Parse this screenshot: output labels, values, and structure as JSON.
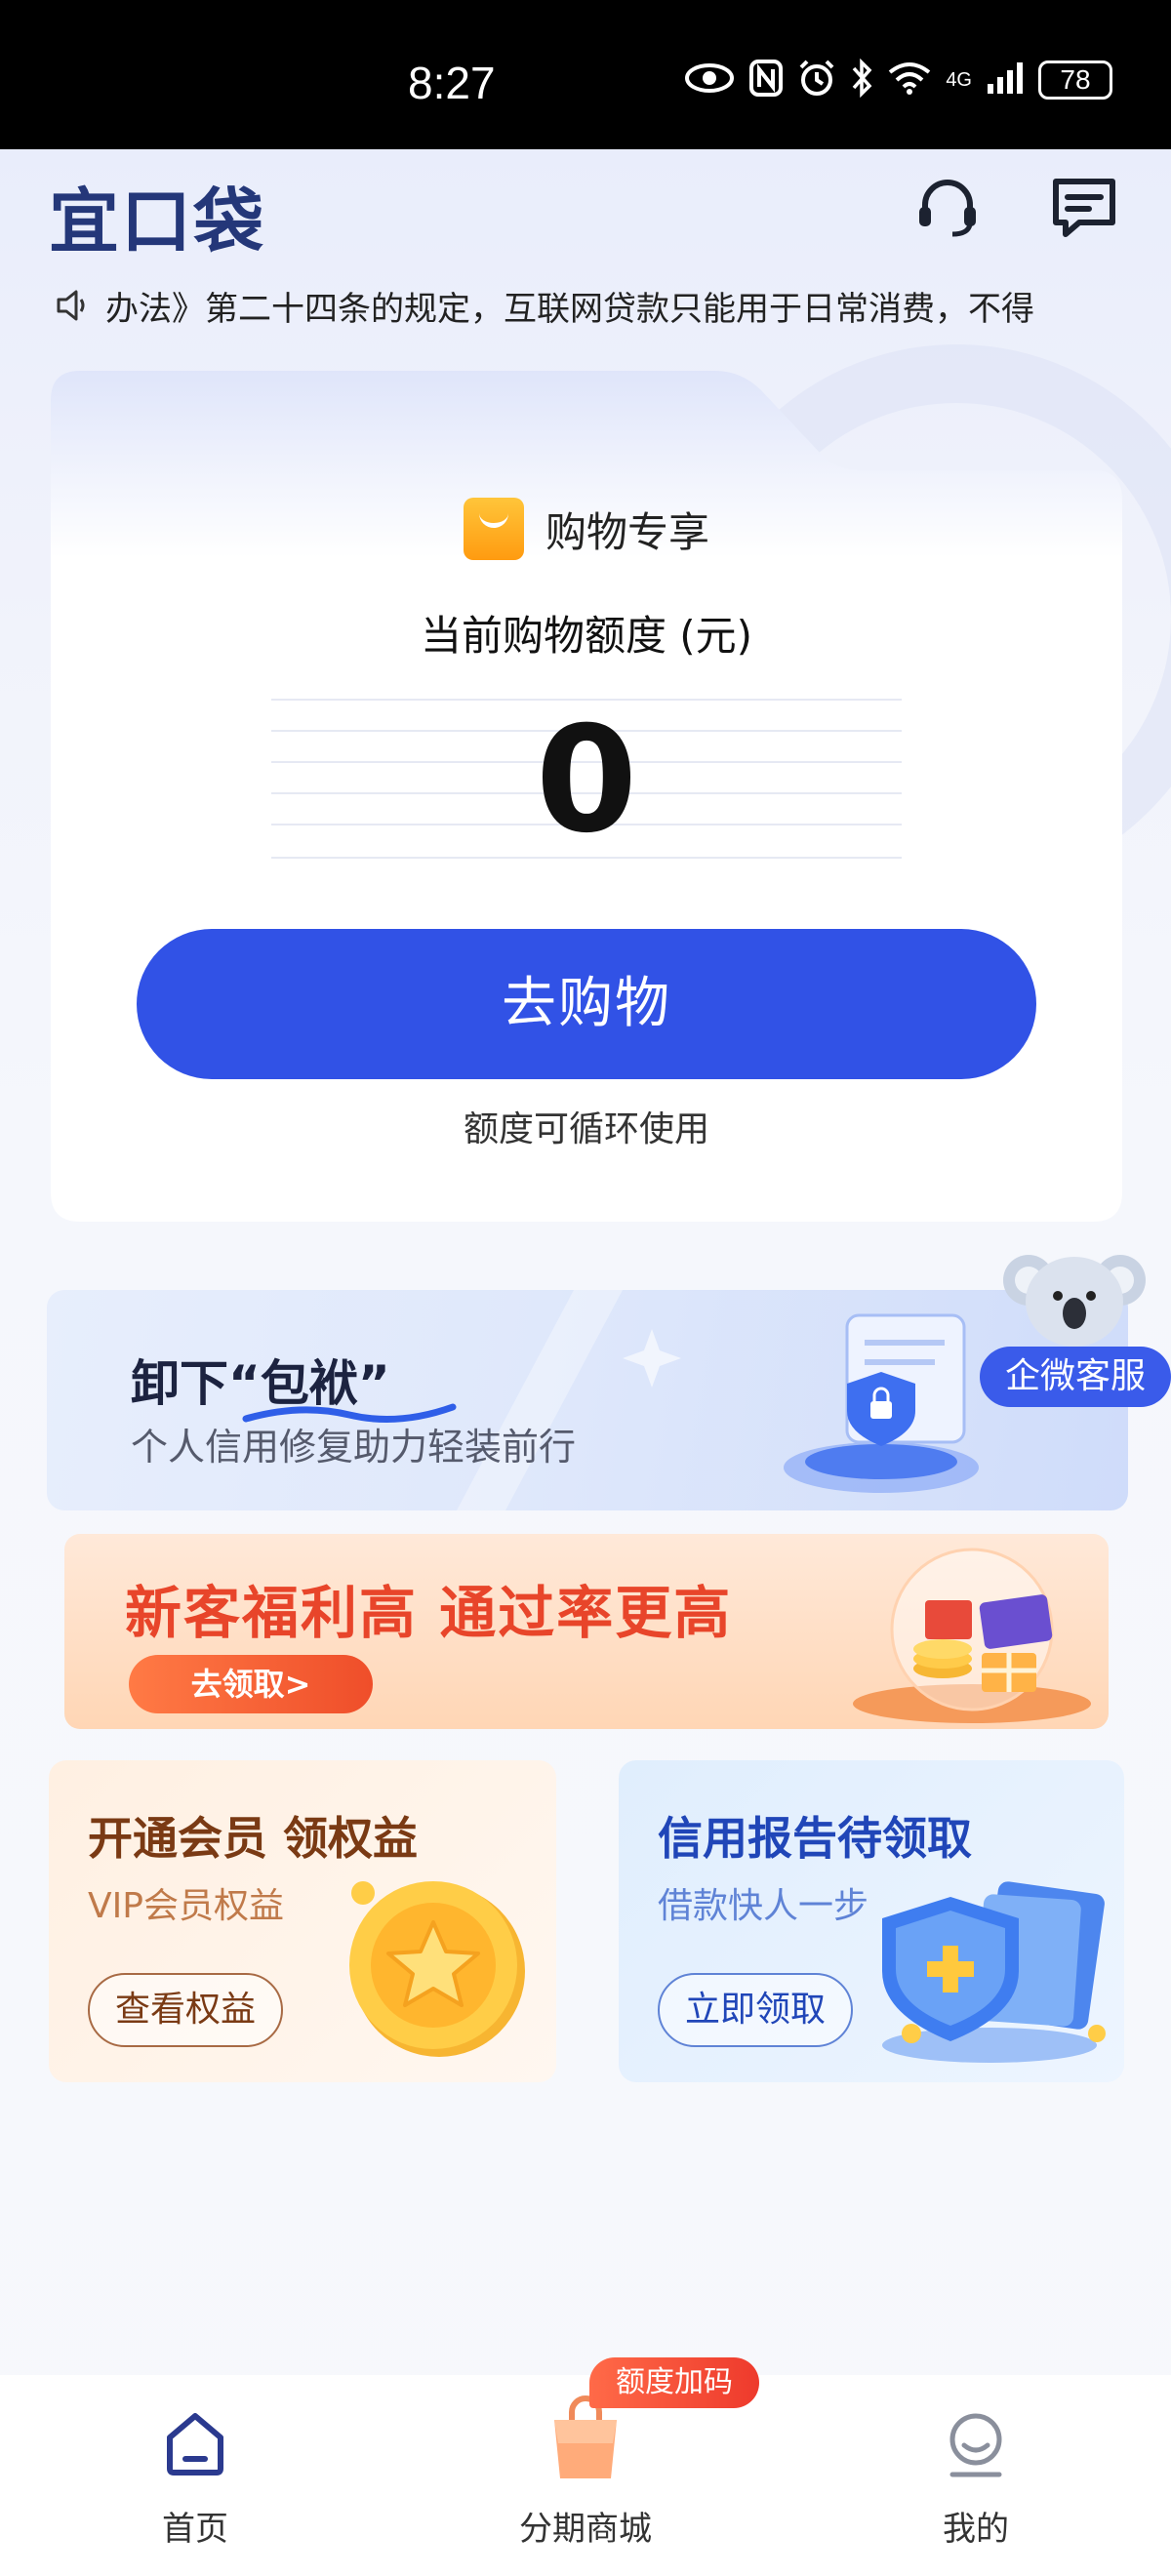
{
  "status_bar": {
    "time": "8:27",
    "network": "4G",
    "battery": "78",
    "icons": [
      "eye-icon",
      "nfc-icon",
      "alarm-icon",
      "bluetooth-icon",
      "wifi-icon",
      "signal-icon",
      "battery-icon"
    ]
  },
  "header": {
    "logo": "宜口袋",
    "icons": [
      "headset-icon",
      "message-icon"
    ]
  },
  "notice": {
    "text": "办法》第二十四条的规定，互联网贷款只能用于日常消费，不得"
  },
  "credit_card": {
    "shop_label": "购物专享",
    "credit_label": "当前购物额度 (元)",
    "amount": "0",
    "button_label": "去购物",
    "note": "额度可循环使用"
  },
  "repair_banner": {
    "title": "卸下“包袱”",
    "subtitle": "个人信用修复助力轻装前行"
  },
  "service": {
    "label": "企微客服"
  },
  "promo_banner": {
    "title": "新客福利高 通过率更高",
    "button_label": "去领取>"
  },
  "vip_card": {
    "title": "开通会员 领权益",
    "subtitle": "VIP会员权益",
    "button_label": "查看权益"
  },
  "credit_report_card": {
    "title": "信用报告待领取",
    "subtitle": "借款快人一步",
    "button_label": "立即领取"
  },
  "bottom_nav": {
    "items": [
      {
        "label": "首页",
        "icon": "home-icon"
      },
      {
        "label": "分期商城",
        "icon": "shopping-bag-icon"
      },
      {
        "label": "我的",
        "icon": "profile-icon"
      }
    ],
    "badge": "额度加码"
  },
  "colors": {
    "primary": "#3152E6",
    "logo": "#243779",
    "promo_red": "#E8452A",
    "status_bar": "#000000"
  }
}
